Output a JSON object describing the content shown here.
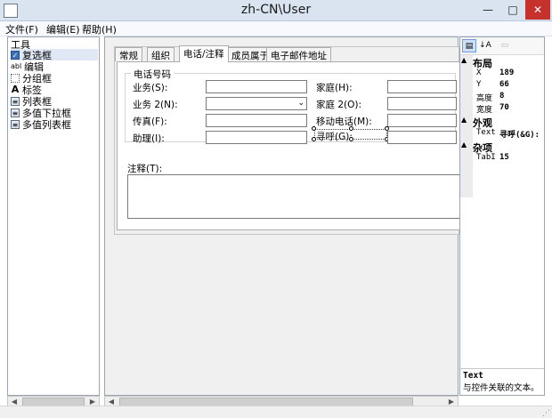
{
  "window": {
    "title": "zh-CN\\User"
  },
  "menu": [
    "文件(F)",
    "编辑(E)",
    "帮助(H)"
  ],
  "toolbox": {
    "header": "工具",
    "items": [
      {
        "label": "复选框",
        "icon": "checkbox-icon",
        "glyph": "✓",
        "selected": true
      },
      {
        "label": "编辑",
        "icon": "textbox-icon",
        "glyph": "abl",
        "selected": false
      },
      {
        "label": "分组框",
        "icon": "groupbox-icon",
        "glyph": "",
        "selected": false
      },
      {
        "label": "标签",
        "icon": "label-icon",
        "glyph": "A",
        "selected": false
      },
      {
        "label": "列表框",
        "icon": "listbox-icon",
        "glyph": "≡",
        "selected": false
      },
      {
        "label": "多值下拉框",
        "icon": "multivalue-combo-icon",
        "glyph": "≡",
        "selected": false
      },
      {
        "label": "多值列表框",
        "icon": "multivalue-list-icon",
        "glyph": "≡",
        "selected": false
      }
    ]
  },
  "designer": {
    "tabs": [
      {
        "label": "常规",
        "active": false
      },
      {
        "label": "组织",
        "active": false
      },
      {
        "label": "电话/注释",
        "active": true
      },
      {
        "label": "成员属于",
        "active": false
      },
      {
        "label": "电子邮件地址",
        "active": false
      }
    ],
    "phone_group_title": "电话号码",
    "fields": {
      "business": "业务(S):",
      "business2": "业务 2(N):",
      "fax": "传真(F):",
      "assistant": "助理(I):",
      "home": "家庭(H):",
      "home2": "家庭 2(O):",
      "mobile": "移动电话(M):",
      "pager": "寻呼(G):"
    },
    "notes_label": "注释(T):"
  },
  "properties": {
    "categories": [
      {
        "name": "布局",
        "items": [
          {
            "name": "X",
            "value": "189"
          },
          {
            "name": "Y",
            "value": "66"
          },
          {
            "name": "高度",
            "value": "8"
          },
          {
            "name": "宽度",
            "value": "70"
          }
        ]
      },
      {
        "name": "外观",
        "items": [
          {
            "name": "Text",
            "value": "寻呼(&G):"
          }
        ]
      },
      {
        "name": "杂项",
        "items": [
          {
            "name": "TabI",
            "value": "15"
          }
        ]
      }
    ],
    "description_title": "Text",
    "description_text": "与控件关联的文本。"
  },
  "colors": {
    "selection": "#dfe8f4",
    "close_button": "#c7312b",
    "titlebar": "#d9e4f0"
  }
}
